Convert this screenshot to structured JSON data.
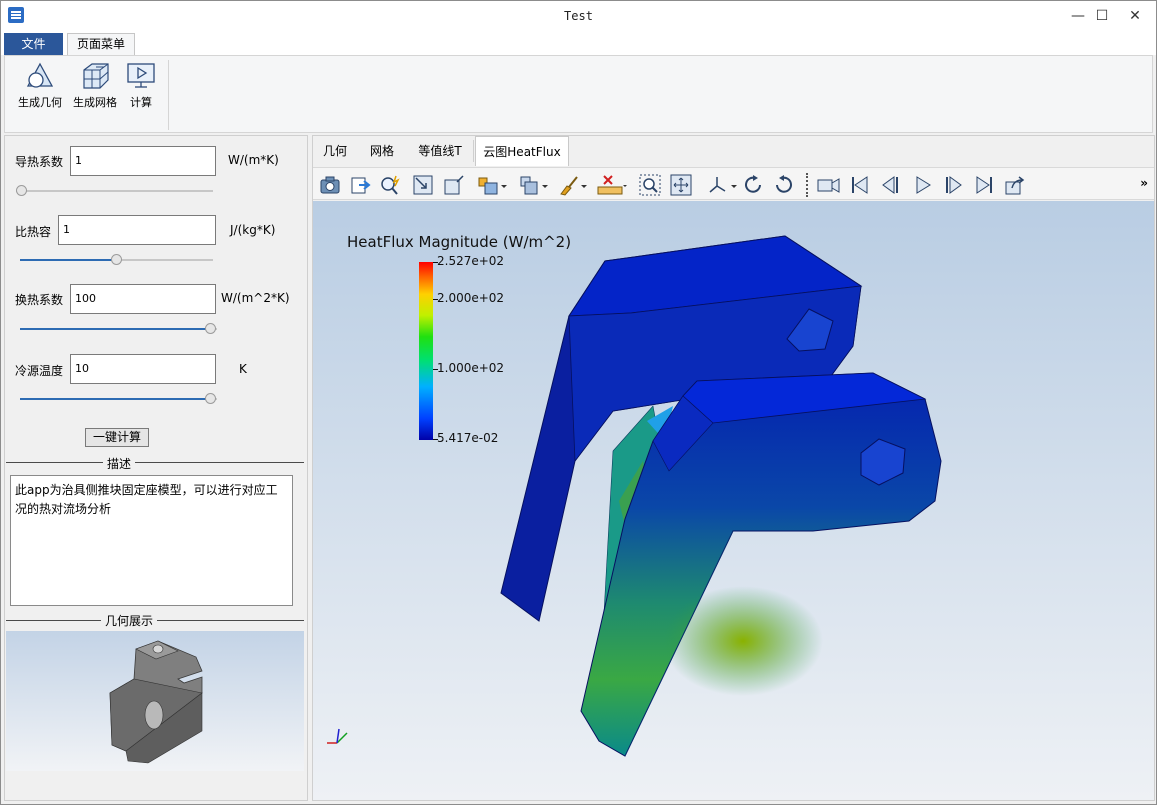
{
  "window": {
    "title": "Test",
    "minimize": "—",
    "maximize": "☐",
    "close": "✕"
  },
  "ribbon": {
    "tabs": [
      {
        "label": "文件"
      },
      {
        "label": "页面菜单"
      }
    ],
    "buttons": [
      {
        "label": "生成几何",
        "icon": "geometry-icon"
      },
      {
        "label": "生成网格",
        "icon": "mesh-icon"
      },
      {
        "label": "计算",
        "icon": "compute-icon"
      }
    ]
  },
  "params": [
    {
      "label": "导热系数",
      "value": "1",
      "unit": "W/(m*K)",
      "slider_level": 0.0
    },
    {
      "label": "比热容",
      "value": "1",
      "unit": "J/(kg*K)",
      "slider_level": 0.5
    },
    {
      "label": "换热系数",
      "value": "100",
      "unit": "W/(m^2*K)",
      "slider_level": 1.0
    },
    {
      "label": "冷源温度",
      "value": "10",
      "unit": "K",
      "slider_level": 1.0
    }
  ],
  "calc_button": "一键计算",
  "description": {
    "title": "描述",
    "text": "此app为治具侧推块固定座模型，可以进行对应工况的热对流场分析"
  },
  "geometry_preview": {
    "title": "几何展示"
  },
  "view_tabs": [
    {
      "label": "几何",
      "active": false
    },
    {
      "label": "网格",
      "active": false
    },
    {
      "label": "等值线T",
      "active": false
    },
    {
      "label": "云图HeatFlux",
      "active": true
    }
  ],
  "toolbar": {
    "icons": [
      "camera-icon",
      "export-icon",
      "zoom-magic-icon",
      "fit-box-icon",
      "box-view-icon",
      "color-box-icon",
      "display-mode-icon",
      "brush-icon",
      "ruler-icon",
      "zoom-window-icon",
      "pan-icon",
      "axes-icon",
      "rotate-cw-icon",
      "rotate-ccw-icon",
      "video-icon",
      "first-frame-icon",
      "prev-frame-icon",
      "play-icon",
      "next-frame-icon",
      "last-frame-icon",
      "share-icon"
    ],
    "more": "»"
  },
  "colormap": {
    "title": "HeatFlux Magnitude (W/m^2)",
    "max_label": "2.527e+02",
    "mid_high_label": "2.000e+02",
    "mid_label": "1.000e+02",
    "min_label": "5.417e-02",
    "max": 252.7,
    "min": 0.05417,
    "colors": {
      "low": "#0000a8",
      "mid": "#20e010",
      "high": "#ff0000"
    }
  }
}
